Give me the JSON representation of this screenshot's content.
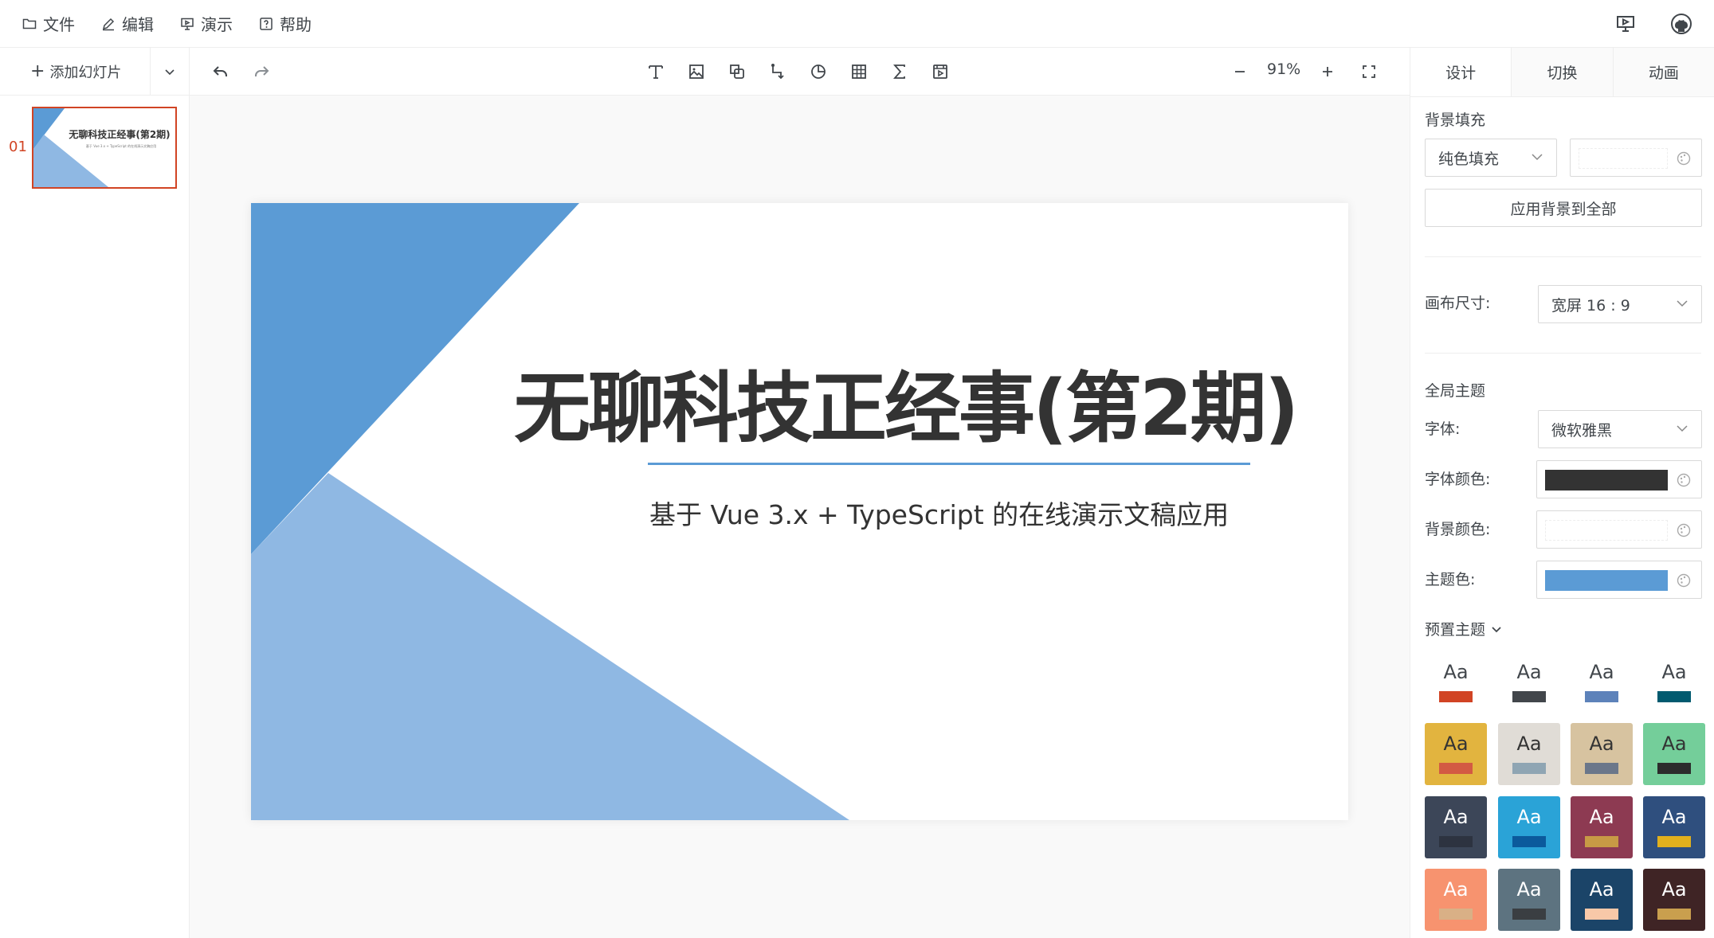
{
  "menubar": {
    "items": [
      {
        "label": "文件",
        "icon": "folder-icon"
      },
      {
        "label": "编辑",
        "icon": "pencil-icon"
      },
      {
        "label": "演示",
        "icon": "presentation-icon"
      },
      {
        "label": "帮助",
        "icon": "help-icon"
      }
    ],
    "right_icons": [
      "present-icon",
      "github-icon"
    ]
  },
  "left_panel": {
    "add_slide_label": "添加幻灯片",
    "slides": [
      {
        "index": "01",
        "title": "无聊科技正经事(第2期)",
        "subtitle": "基于 Vue 3.x + TypeScript 的在线演示文稿应用"
      }
    ]
  },
  "toolbar": {
    "zoom": "91%",
    "tools": [
      "undo-icon",
      "redo-icon",
      "text-icon",
      "image-icon",
      "shape-icon",
      "line-icon",
      "chart-icon",
      "table-icon",
      "formula-icon",
      "media-icon",
      "zoom-out-icon",
      "zoom-in-icon",
      "fullscreen-icon"
    ]
  },
  "slide": {
    "title": "无聊科技正经事(第2期)",
    "subtitle": "基于 Vue 3.x + TypeScript 的在线演示文稿应用",
    "colors": {
      "dark_blue": "#5b9bd5",
      "light_blue": "#8fb8e3",
      "line": "#5b9bd5"
    }
  },
  "right_panel": {
    "tabs": [
      "设计",
      "切换",
      "动画"
    ],
    "active_tab": "设计",
    "background_fill_label": "背景填充",
    "fill_type": "纯色填充",
    "apply_all_label": "应用背景到全部",
    "canvas_size_label": "画布尺寸:",
    "canvas_size_value": "宽屏 16 : 9",
    "global_theme_label": "全局主题",
    "font_label": "字体:",
    "font_value": "微软雅黑",
    "font_color_label": "字体颜色:",
    "font_color": "#333333",
    "bg_color_label": "背景颜色:",
    "bg_color": "#ffffff",
    "theme_color_label": "主题色:",
    "theme_color": "#5b9bd5",
    "preset_label": "预置主题",
    "presets": [
      {
        "text": "Aa",
        "bg": "#ffffff",
        "fg": "#41464b",
        "bar": "#d14424"
      },
      {
        "text": "Aa",
        "bg": "#ffffff",
        "fg": "#41464b",
        "bar": "#42464b"
      },
      {
        "text": "Aa",
        "bg": "#ffffff",
        "fg": "#41464b",
        "bar": "#5d82ba"
      },
      {
        "text": "Aa",
        "bg": "#ffffff",
        "fg": "#41464b",
        "bar": "#005a6f"
      },
      {
        "text": "Aa",
        "bg": "#e2b43f",
        "fg": "#333333",
        "bar": "#d35a43"
      },
      {
        "text": "Aa",
        "bg": "#e0dcd6",
        "fg": "#333333",
        "bar": "#8fa5b3"
      },
      {
        "text": "Aa",
        "bg": "#d7c3a0",
        "fg": "#333333",
        "bar": "#6b778a"
      },
      {
        "text": "Aa",
        "bg": "#74ce9a",
        "fg": "#333333",
        "bar": "#2c2c2c"
      },
      {
        "text": "Aa",
        "bg": "#3c4658",
        "fg": "#ffffff",
        "bar": "#2d3340"
      },
      {
        "text": "Aa",
        "bg": "#2aa3d7",
        "fg": "#ffffff",
        "bar": "#0b5a9c"
      },
      {
        "text": "Aa",
        "bg": "#8d3a52",
        "fg": "#ffffff",
        "bar": "#c79a45"
      },
      {
        "text": "Aa",
        "bg": "#2f4f7e",
        "fg": "#ffffff",
        "bar": "#e2b01c"
      },
      {
        "text": "Aa",
        "bg": "#f7936f",
        "fg": "#ffffff",
        "bar": "#d9b086"
      },
      {
        "text": "Aa",
        "bg": "#5d7380",
        "fg": "#ffffff",
        "bar": "#3a3e42"
      },
      {
        "text": "Aa",
        "bg": "#1b4468",
        "fg": "#ffffff",
        "bar": "#f8c8a8"
      },
      {
        "text": "Aa",
        "bg": "#3f2425",
        "fg": "#ffffff",
        "bar": "#c99f4e"
      }
    ]
  }
}
